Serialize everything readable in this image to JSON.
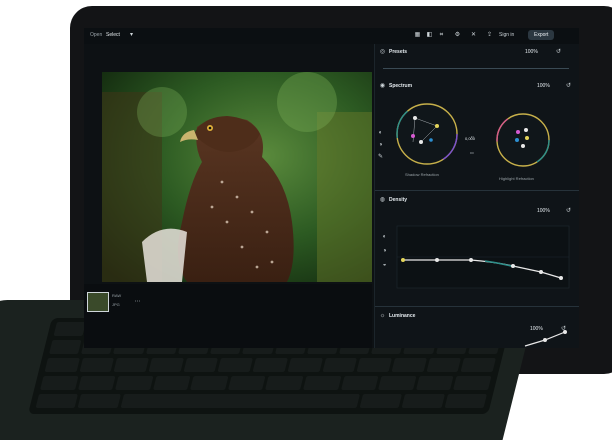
{
  "topbar": {
    "view_label": "Open",
    "view_value": "Select",
    "sign_in": "Sign in",
    "export": "Export"
  },
  "panel": {
    "presets": {
      "title": "Presets",
      "value": "100%"
    },
    "spectrum": {
      "title": "Spectrum",
      "value": "100%",
      "center_value": "0,000",
      "shadow_label": "Shadow Refraction",
      "highlight_label": "Highlight Refraction"
    },
    "density": {
      "title": "Density",
      "value": "100%"
    },
    "luminance": {
      "title": "Luminance",
      "value": "100%"
    }
  },
  "filmstrip": {
    "label_a": "RAW",
    "label_b": "JPG"
  },
  "colors": {
    "accent": "#2d8f8a",
    "curve": "#e8e8e8",
    "wheel_ring": "#c7b04a"
  }
}
